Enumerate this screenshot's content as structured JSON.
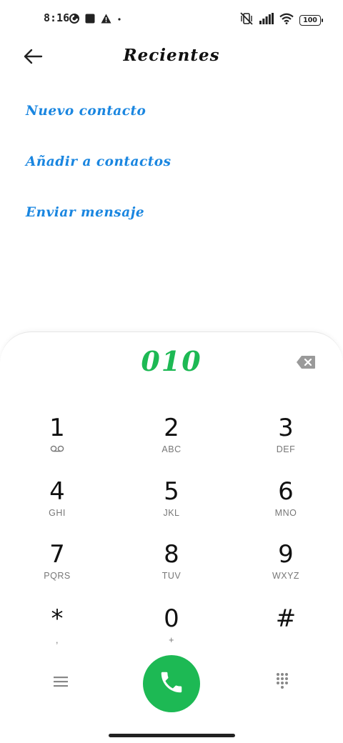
{
  "status_bar": {
    "time": "8:16",
    "battery": "100"
  },
  "header": {
    "title": "Recientes"
  },
  "actions": [
    {
      "label": "Nuevo contacto"
    },
    {
      "label": "Añadir a contactos"
    },
    {
      "label": "Enviar mensaje"
    }
  ],
  "dialpad": {
    "number": "010",
    "keys": [
      {
        "digit": "1",
        "letters": ""
      },
      {
        "digit": "2",
        "letters": "ABC"
      },
      {
        "digit": "3",
        "letters": "DEF"
      },
      {
        "digit": "4",
        "letters": "GHI"
      },
      {
        "digit": "5",
        "letters": "JKL"
      },
      {
        "digit": "6",
        "letters": "MNO"
      },
      {
        "digit": "7",
        "letters": "PQRS"
      },
      {
        "digit": "8",
        "letters": "TUV"
      },
      {
        "digit": "9",
        "letters": "WXYZ"
      },
      {
        "digit": "*",
        "letters": ","
      },
      {
        "digit": "0",
        "letters": "+"
      },
      {
        "digit": "#",
        "letters": ""
      }
    ]
  },
  "icons": {
    "key_1_sub": "voicemail-icon",
    "call": "phone-icon",
    "menu": "hamburger-menu-icon",
    "keypad": "dialpad-grid-icon",
    "backspace": "backspace-icon",
    "back": "arrow-left-icon"
  },
  "colors": {
    "accent_blue": "#1a86e0",
    "call_green": "#1db954",
    "number_green": "#1db954"
  }
}
